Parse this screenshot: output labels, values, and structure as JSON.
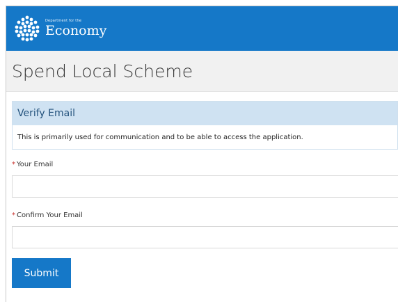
{
  "brand": {
    "department_line": "Department for the",
    "name": "Economy",
    "logo_icon": "dotted-flower-logo-icon",
    "header_color": "#1578c8"
  },
  "page": {
    "title": "Spend Local Scheme"
  },
  "panel": {
    "heading": "Verify Email",
    "description": "This is primarily used for communication and to be able to access the application."
  },
  "form": {
    "required_marker": "*",
    "email_label": "Your Email",
    "email_value": "",
    "confirm_email_label": "Confirm Your Email",
    "confirm_email_value": "",
    "submit_label": "Submit"
  }
}
